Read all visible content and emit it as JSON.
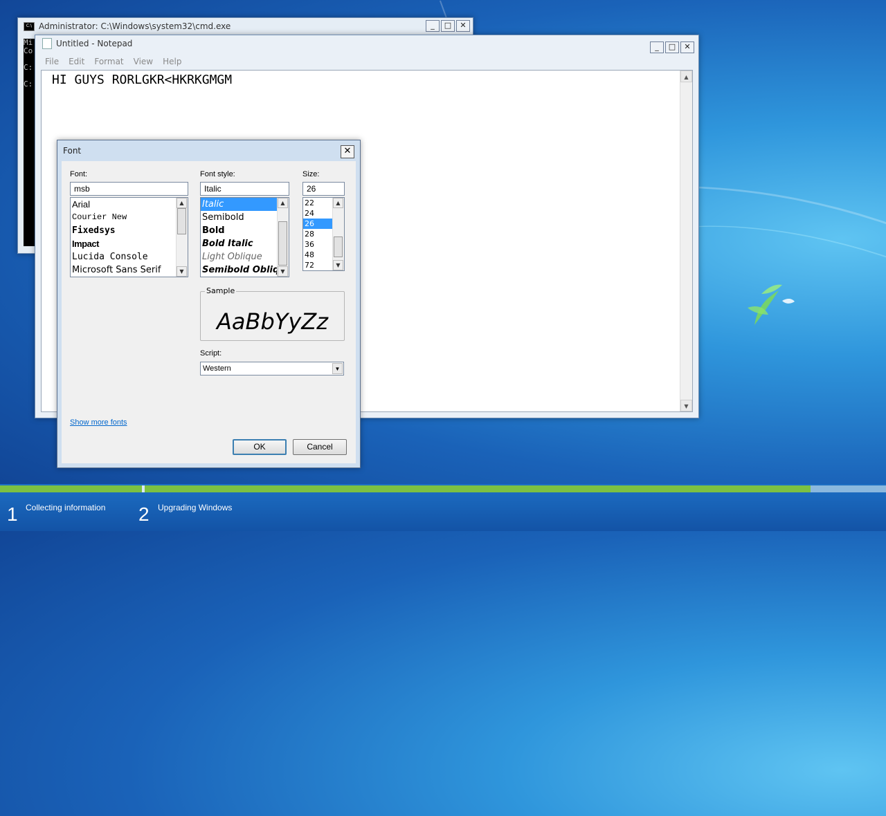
{
  "cmd_window": {
    "title": "Administrator: C:\\Windows\\system32\\cmd.exe",
    "lines": [
      "Mi",
      "Co",
      "",
      "C:",
      "",
      "C:"
    ],
    "minimize": "_",
    "maximize": "□",
    "close": "✕"
  },
  "notepad": {
    "title": "Untitled - Notepad",
    "menu": [
      "File",
      "Edit",
      "Format",
      "View",
      "Help"
    ],
    "text": "HI GUYS RORLGKR<HKRKGMGM",
    "minimize": "_",
    "maximize": "□",
    "close": "✕"
  },
  "font_dialog": {
    "title": "Font",
    "close": "✕",
    "font_label": "Font:",
    "font_value": "msb",
    "fonts": [
      "Arial",
      "Courier New",
      "Fixedsys",
      "Impact",
      "Lucida Console",
      "Microsoft Sans Serif"
    ],
    "style_label": "Font style:",
    "style_value": "Italic",
    "styles": [
      "Italic",
      "Semibold",
      "Bold",
      "Bold Italic",
      "Light Oblique",
      "Semibold Oblique"
    ],
    "selected_style": "Italic",
    "size_label": "Size:",
    "size_value": "26",
    "sizes": [
      "22",
      "24",
      "26",
      "28",
      "36",
      "48",
      "72"
    ],
    "selected_size": "26",
    "sample_label": "Sample",
    "sample_text": "AaBbYyZz",
    "script_label": "Script:",
    "script_value": "Western",
    "show_more_fonts": "Show more fonts",
    "ok": "OK",
    "cancel": "Cancel"
  },
  "setup": {
    "steps": [
      {
        "number": "1",
        "label": "Collecting information"
      },
      {
        "number": "2",
        "label": "Upgrading Windows"
      }
    ],
    "progress_fraction": 0.915
  },
  "colors": {
    "selection": "#3399ff",
    "progress_green": "#7cc142",
    "link": "#0066cc"
  }
}
